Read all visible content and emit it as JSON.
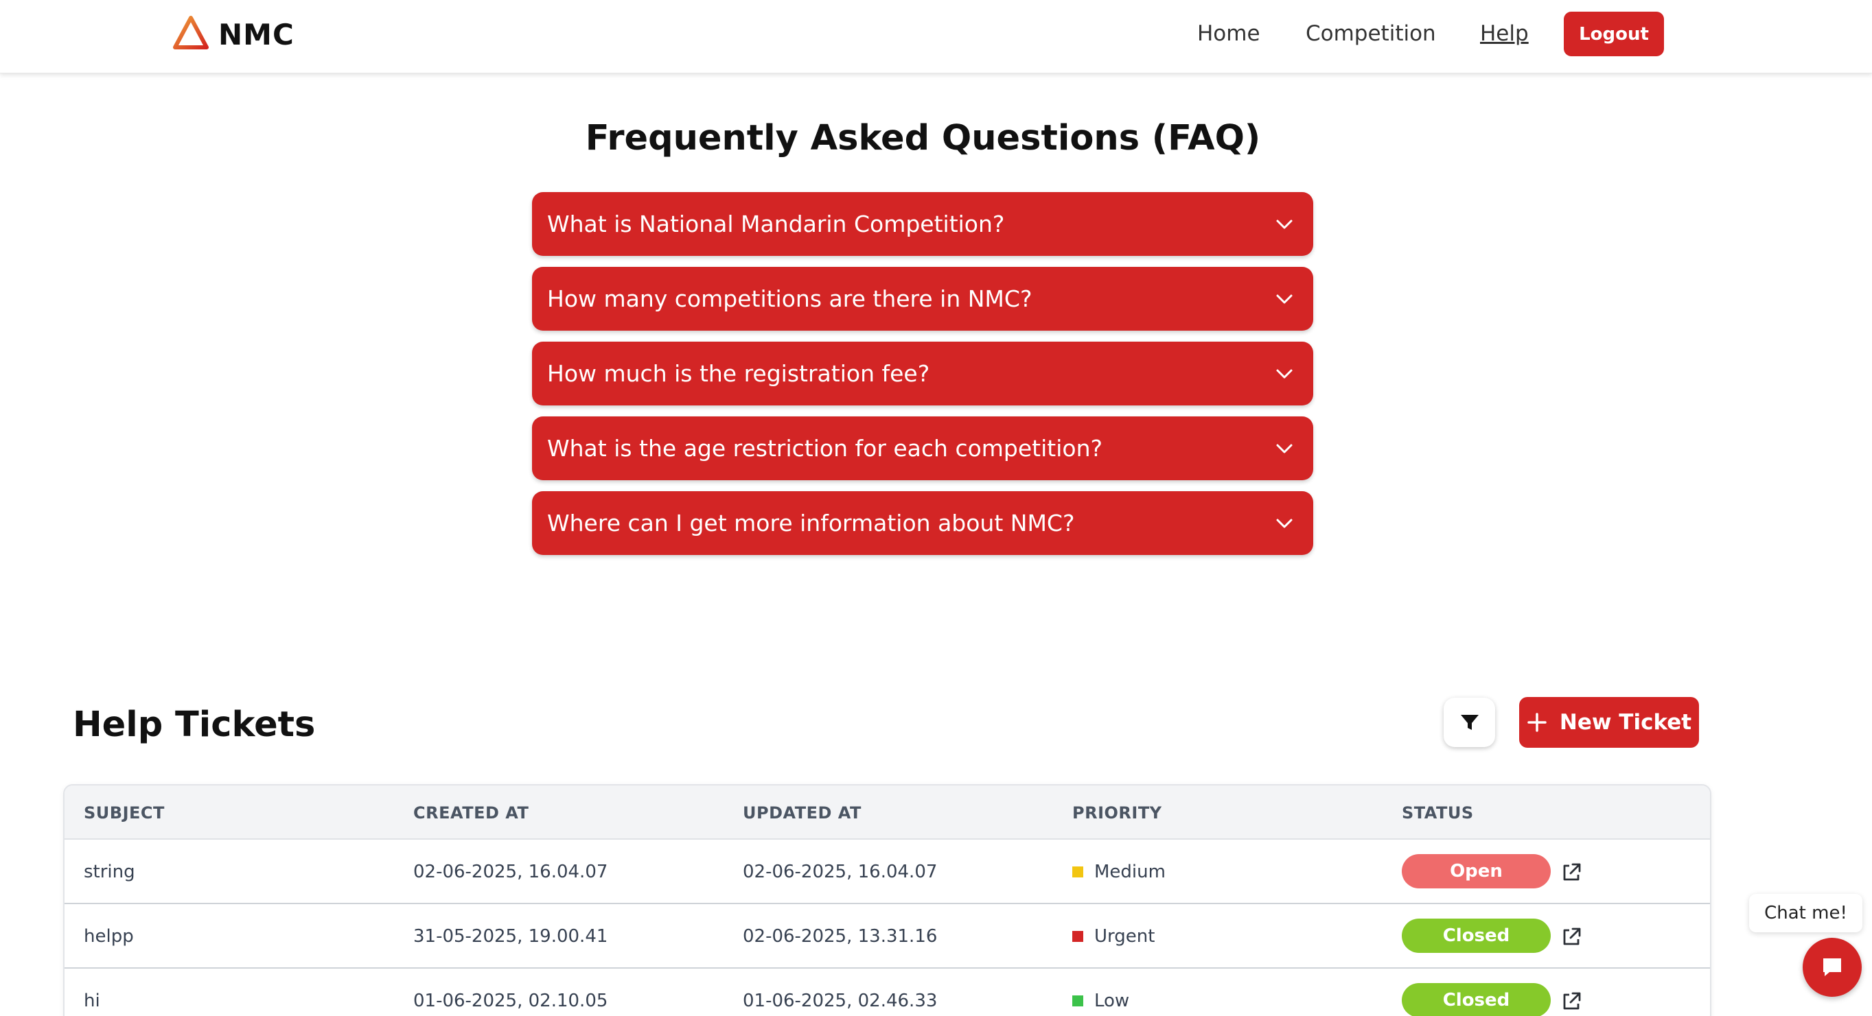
{
  "header": {
    "brand": "NMC",
    "nav": {
      "home": "Home",
      "competition": "Competition",
      "help": "Help"
    },
    "logout_label": "Logout"
  },
  "faq": {
    "title": "Frequently Asked Questions (FAQ)",
    "items": [
      {
        "question": "What is National Mandarin Competition?"
      },
      {
        "question": "How many competitions are there in NMC?"
      },
      {
        "question": "How much is the registration fee?"
      },
      {
        "question": "What is the age restriction for each competition?"
      },
      {
        "question": "Where can I get more information about NMC?"
      }
    ]
  },
  "tickets": {
    "title": "Help Tickets",
    "new_ticket_label": "New Ticket",
    "columns": {
      "subject": "SUBJECT",
      "created_at": "CREATED AT",
      "updated_at": "UPDATED AT",
      "priority": "PRIORITY",
      "status": "STATUS"
    },
    "rows": [
      {
        "subject": "string",
        "created_at": "02-06-2025, 16.04.07",
        "updated_at": "02-06-2025, 16.04.07",
        "priority": "Medium",
        "priority_color": "#f2c511",
        "status": "Open",
        "status_color": "#ef6b6b"
      },
      {
        "subject": "helpp",
        "created_at": "31-05-2025, 19.00.41",
        "updated_at": "02-06-2025, 13.31.16",
        "priority": "Urgent",
        "priority_color": "#d32525",
        "status": "Closed",
        "status_color": "#86c92a"
      },
      {
        "subject": "hi",
        "created_at": "01-06-2025, 02.10.05",
        "updated_at": "01-06-2025, 02.46.33",
        "priority": "Low",
        "priority_color": "#3cc24a",
        "status": "Closed",
        "status_color": "#86c92a"
      }
    ]
  },
  "chat": {
    "label": "Chat me!"
  },
  "colors": {
    "accent": "#d32525"
  },
  "icons": {
    "brand_logo": "triangle-logo-icon",
    "faq_toggle": "chevron-down-icon",
    "filter": "filter-icon",
    "new_ticket": "plus-icon",
    "ticket_link": "external-link-icon",
    "chat": "chat-bubble-icon"
  }
}
